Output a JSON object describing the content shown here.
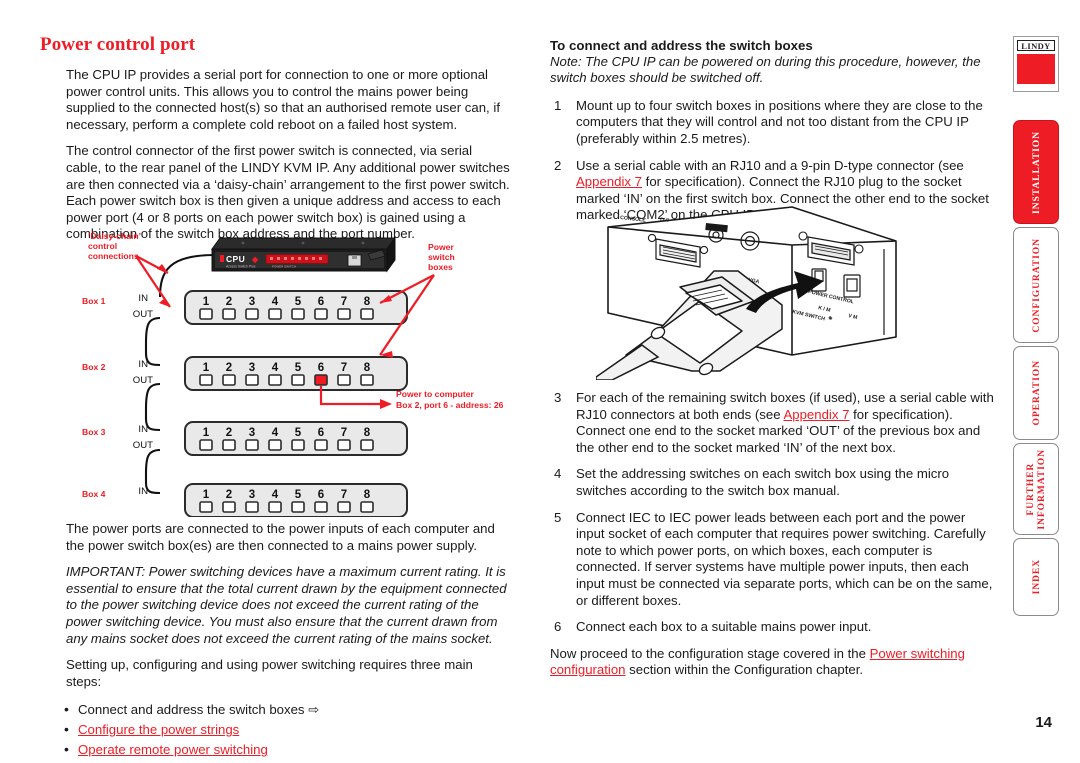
{
  "document": {
    "page_number": "14",
    "accent_color": "#ee1c25"
  },
  "left_column": {
    "title": "Power control port",
    "paragraph_1": "The CPU IP provides a serial port for connection to one or more optional power control units. This allows you to control the mains power being supplied to the connected host(s) so that an authorised remote user can, if necessary, perform a complete cold reboot on a failed host system.",
    "paragraph_2": "The control connector of the first power switch is connected, via serial cable, to the rear panel of the LINDY KVM IP. Any additional power switches are then connected via a ‘daisy-chain’ arrangement to the first power switch. Each power switch box is then given a unique address and access to each power port (4 or 8 ports on each power switch box) is gained using a combination of the switch box address and the port number.",
    "paragraph_3": "The power ports are connected to the power inputs of each computer and the power switch box(es) are then connected to a mains power supply.",
    "important_note": "IMPORTANT: Power switching devices have a maximum current rating. It is essential to ensure that the total current drawn by the equipment connected to the power switching device does not exceed the current rating of the power switching device. You must also ensure that the current drawn from any mains socket does not exceed the current rating of the mains socket.",
    "steps_intro": "Setting up, configuring and using power switching requires three main steps:",
    "step_bullets": [
      {
        "text": "Connect and address the switch boxes",
        "suffix": "⇨",
        "link": false
      },
      {
        "text": "Configure the power strings",
        "suffix": "",
        "link": true
      },
      {
        "text": "Operate remote power switching",
        "suffix": "",
        "link": true
      }
    ]
  },
  "diagram": {
    "callout_daisy_chain": "‘Daisy-chain’ control connections",
    "callout_daisy_chain_lines": [
      "‘Daisy-chain’",
      "control",
      "connections"
    ],
    "callout_power_switch_boxes_lines": [
      "Power",
      "switch",
      "boxes"
    ],
    "callout_power_to_computer_line1": "Power to computer",
    "callout_power_to_computer_line2": "Box 2, port 6 - address: 26",
    "device_label_main": "CPU",
    "device_label_sub": "Access Switch Plus",
    "boxes": [
      {
        "label": "Box 1",
        "in_label": "IN",
        "out_label": "OUT",
        "ports": [
          "1",
          "2",
          "3",
          "4",
          "5",
          "6",
          "7",
          "8"
        ],
        "active_port": null
      },
      {
        "label": "Box 2",
        "in_label": "IN",
        "out_label": "OUT",
        "ports": [
          "1",
          "2",
          "3",
          "4",
          "5",
          "6",
          "7",
          "8"
        ],
        "active_port": 6
      },
      {
        "label": "Box 3",
        "in_label": "IN",
        "out_label": "OUT",
        "ports": [
          "1",
          "2",
          "3",
          "4",
          "5",
          "6",
          "7",
          "8"
        ],
        "active_port": null
      },
      {
        "label": "Box 4",
        "in_label": "IN",
        "out_label": "",
        "ports": [
          "1",
          "2",
          "3",
          "4",
          "5",
          "6",
          "7",
          "8"
        ],
        "active_port": null
      }
    ]
  },
  "right_column": {
    "heading": "To connect and address the switch boxes",
    "note": "Note: The CPU IP can be powered on during this procedure, however, the switch boxes should be switched off.",
    "steps": [
      {
        "num": "1",
        "parts": [
          {
            "t": "Mount up to four switch boxes in positions where they are close to the computers that they will control and not too distant from the CPU IP (preferably within 2.5 metres).",
            "link": false
          }
        ]
      },
      {
        "num": "2",
        "parts": [
          {
            "t": "Use a serial cable with an RJ10 and a 9-pin D-type connector (see ",
            "link": false
          },
          {
            "t": "Appendix 7",
            "link": true
          },
          {
            "t": " for specification). Connect the RJ10 plug to the socket marked ‘IN’ on the first switch box. Connect the other end to the socket marked ‘COM2’ on the CPU IP.",
            "link": false
          }
        ]
      },
      {
        "num": "3",
        "parts": [
          {
            "t": "For each of the remaining switch boxes (if used), use a serial cable with RJ10 connectors at both ends (see ",
            "link": false
          },
          {
            "t": "Appendix 7",
            "link": true
          },
          {
            "t": " for specification). Connect one end to the socket marked ‘OUT’ of the previous box and the other end to the socket marked ‘IN’ of the next box.",
            "link": false
          }
        ]
      },
      {
        "num": "4",
        "parts": [
          {
            "t": "Set the addressing switches on each switch box using the micro switches according to the switch box manual.",
            "link": false
          }
        ]
      },
      {
        "num": "5",
        "parts": [
          {
            "t": "Connect IEC to IEC power leads between each port and the power input socket of each computer that requires power switching. Carefully note to which power ports, on which boxes, each computer is connected. If server systems have multiple power inputs, then each input must be connected via separate ports, which can be on the same, or different boxes.",
            "link": false
          }
        ]
      },
      {
        "num": "6",
        "parts": [
          {
            "t": "Connect each box to a suitable mains power input.",
            "link": false
          }
        ]
      }
    ],
    "closing": [
      {
        "t": "Now proceed to the configuration stage covered in the ",
        "link": false
      },
      {
        "t": "Power switching configuration",
        "link": true
      },
      {
        "t": " section within the Configuration chapter.",
        "link": false
      }
    ]
  },
  "sidebar": {
    "logo_text": "LINDY",
    "tabs": [
      {
        "label": "INSTALLATION",
        "active": true
      },
      {
        "label": "CONFIGURATION",
        "active": false
      },
      {
        "label": "OPERATION",
        "active": false
      },
      {
        "label": "FURTHER\nINFORMATION",
        "active": false
      },
      {
        "label": "INDEX",
        "active": false
      }
    ]
  }
}
